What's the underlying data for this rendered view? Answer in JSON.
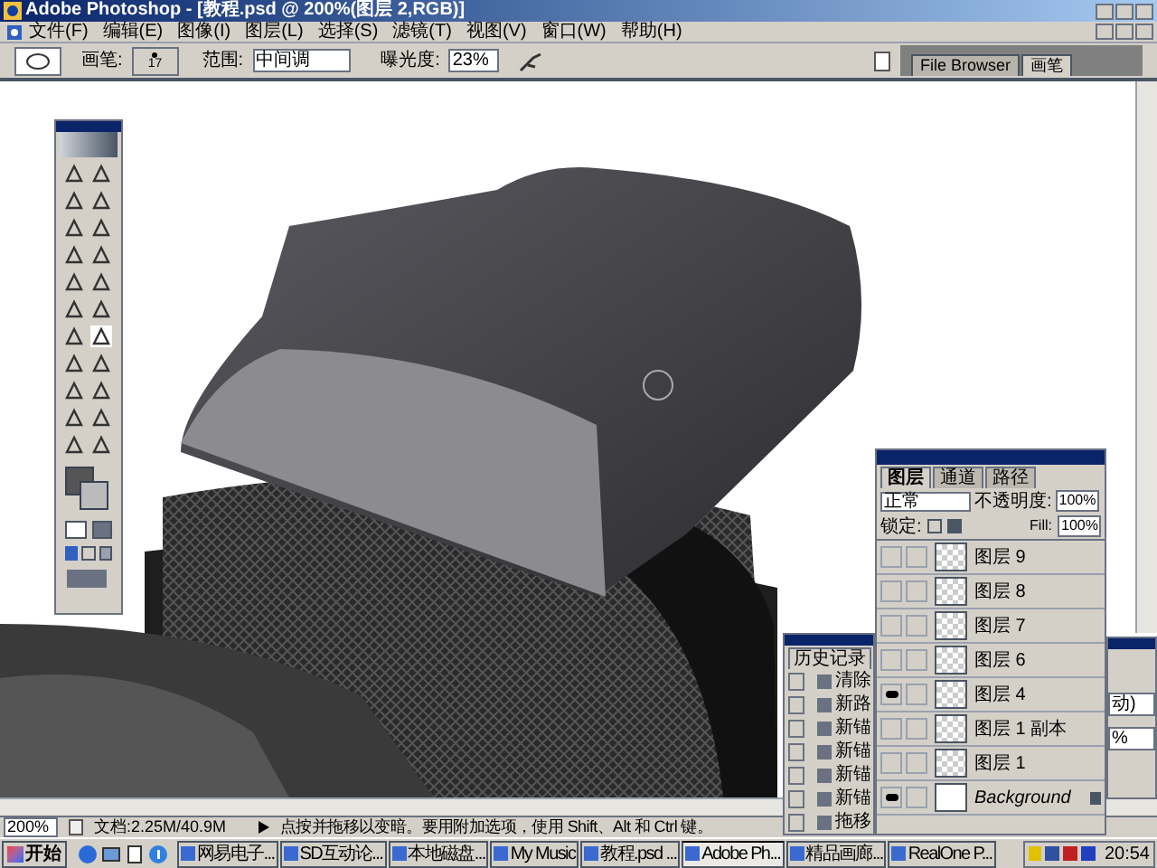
{
  "window": {
    "title": "Adobe Photoshop - [教程.psd @ 200%(图层 2,RGB)]"
  },
  "menu": [
    "文件(F)",
    "编辑(E)",
    "图像(I)",
    "图层(L)",
    "选择(S)",
    "滤镜(T)",
    "视图(V)",
    "窗口(W)",
    "帮助(H)"
  ],
  "options_bar": {
    "brush_label": "画笔:",
    "brush_size": "17",
    "range_label": "范围:",
    "range_value": "中间调",
    "exposure_label": "曝光度:",
    "exposure_value": "23%"
  },
  "palette_well": {
    "tabs": [
      {
        "label": "File Browser",
        "selected": false
      },
      {
        "label": "画笔",
        "selected": true
      }
    ]
  },
  "history_panel": {
    "tab": "历史记录",
    "items": [
      {
        "label": "清除",
        "checked": false
      },
      {
        "label": "新路",
        "checked": false
      },
      {
        "label": "新锚",
        "checked": false
      },
      {
        "label": "新锚",
        "checked": false
      },
      {
        "label": "新锚",
        "checked": false
      },
      {
        "label": "新锚",
        "checked": false
      },
      {
        "label": "拖移",
        "checked": false
      }
    ]
  },
  "right_panel": {
    "field_1": "动)",
    "field_2": "%"
  },
  "layers_panel": {
    "tabs": [
      {
        "label": "图层",
        "selected": true
      },
      {
        "label": "通道",
        "selected": false
      },
      {
        "label": "路径",
        "selected": false
      }
    ],
    "blend_mode": "正常",
    "opacity_label": "不透明度:",
    "opacity": "100%",
    "lock_label": "锁定:",
    "fill_label": "Fill:",
    "fill": "100%",
    "layers": [
      {
        "name": "图层 9",
        "visible": false,
        "kind": "layer"
      },
      {
        "name": "图层 8",
        "visible": false,
        "kind": "layer"
      },
      {
        "name": "图层 7",
        "visible": false,
        "kind": "layer"
      },
      {
        "name": "图层 6",
        "visible": false,
        "kind": "layer"
      },
      {
        "name": "图层 4",
        "visible": true,
        "kind": "layer"
      },
      {
        "name": "图层 1 副本",
        "visible": false,
        "kind": "layer"
      },
      {
        "name": "图层 1",
        "visible": false,
        "kind": "layer"
      },
      {
        "name": "Background",
        "visible": true,
        "kind": "background"
      }
    ]
  },
  "status_bar": {
    "zoom": "200%",
    "document": "文档:2.25M/40.9M",
    "hint": "点按并拖移以变暗。要用附加选项，使用 Shift、Alt 和 Ctrl 键。"
  },
  "taskbar": {
    "start": "开始",
    "tasks": [
      {
        "label": "网易电子...",
        "selected": false
      },
      {
        "label": "SD互动论...",
        "selected": false
      },
      {
        "label": "本地磁盘...",
        "selected": false
      },
      {
        "label": "My Music",
        "selected": false
      },
      {
        "label": "教程.psd ...",
        "selected": false
      },
      {
        "label": "Adobe Ph...",
        "selected": true
      },
      {
        "label": "精品画廊...",
        "selected": false
      },
      {
        "label": "RealOne P...",
        "selected": false
      }
    ],
    "clock": "20:54"
  }
}
